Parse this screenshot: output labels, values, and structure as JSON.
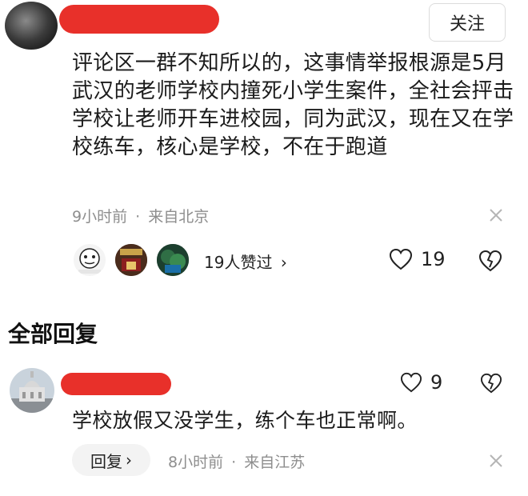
{
  "comment": {
    "follow_label": "关注",
    "text": "评论区一群不知所以的，这事情举报根源是5月武汉的老师学校内撞死小学生案件，全社会抨击学校让老师开车进校园，同为武汉，现在又在学校练车，核心是学校，不在于跑道",
    "time": "9小时前",
    "separator": "·",
    "location": "来自北京",
    "likes_summary": "19人赞过",
    "likes_chevron": "›",
    "like_count": "19",
    "liker_avatars": [
      "avatar-1",
      "avatar-2",
      "avatar-3"
    ]
  },
  "replies_section": {
    "title": "全部回复"
  },
  "reply": {
    "text": "学校放假又没学生，练个车也正常啊。",
    "like_count": "9",
    "reply_label": "回复",
    "reply_chevron": "›",
    "time": "8小时前",
    "separator": "·",
    "location": "来自江苏"
  },
  "colors": {
    "redaction": "#e8302a",
    "meta_text": "#8e8e8e"
  },
  "icons": [
    "heart-icon",
    "broken-heart-icon",
    "close-icon",
    "chevron-right-icon"
  ]
}
